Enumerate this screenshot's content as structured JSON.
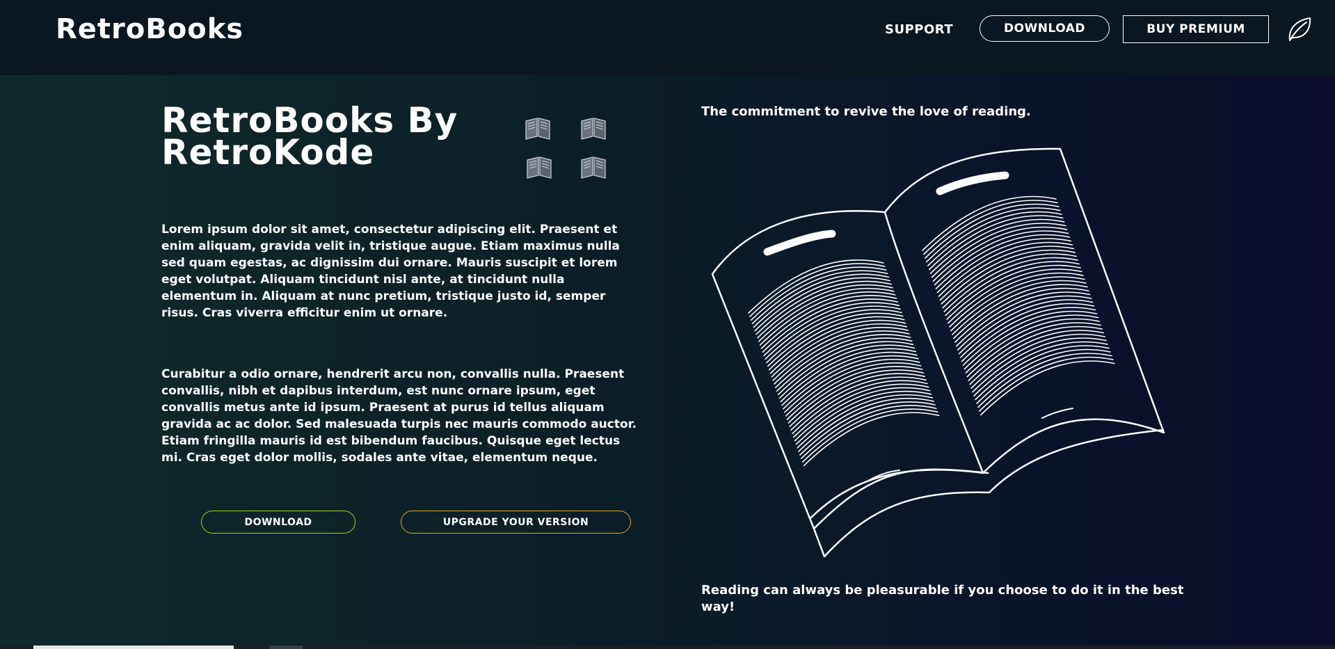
{
  "header": {
    "logo": "RetroBooks",
    "nav": {
      "support": "SUPPORT",
      "download": "DOWNLOAD",
      "buy_premium": "BUY PREMIUM",
      "leaf_icon": "leaf-icon"
    }
  },
  "hero": {
    "title_line1": "RetroBooks By",
    "title_line2": "RetroKode",
    "book_icons": [
      "book-icon",
      "book-icon",
      "book-icon",
      "book-icon"
    ],
    "paragraph1": "Lorem ipsum dolor sit amet, consectetur adipiscing elit. Praesent et enim aliquam, gravida velit in, tristique augue. Etiam maximus nulla sed quam egestas, ac dignissim dui ornare. Mauris suscipit et lorem eget volutpat. Aliquam tincidunt nisl ante, at tincidunt nulla elementum in. Aliquam at nunc pretium, tristique justo id, semper risus. Cras viverra efficitur enim ut ornare.",
    "paragraph2": "Curabitur a odio ornare, hendrerit arcu non, convallis nulla. Praesent convallis, nibh et dapibus interdum, est nunc ornare ipsum, eget convallis metus ante id ipsum. Praesent at purus id tellus aliquam gravida ac ac dolor. Sed malesuada turpis nec mauris commodo auctor. Etiam fringilla mauris id est bibendum faucibus. Quisque eget lectus mi. Cras eget dolor mollis, sodales ante vitae, elementum neque.",
    "download_button": "DOWNLOAD",
    "upgrade_button": "UPGRADE YOUR VERSION"
  },
  "aside": {
    "tagline_top": "The commitment to revive the love of reading.",
    "illustration": "open-book-illustration",
    "tagline_bottom": "Reading can always be pleasurable if you choose to do it in the best way!"
  },
  "colors": {
    "background_left": "#0f2a2a",
    "background_right": "#0a0c2a",
    "topbar": "#0a1620",
    "download_border": "#a3d11f",
    "upgrade_border": "#e8a41c",
    "text": "#ffffff"
  }
}
